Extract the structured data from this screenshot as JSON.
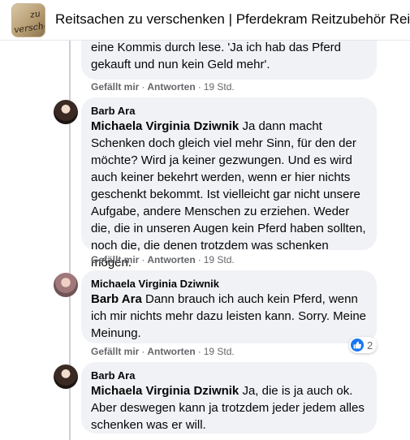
{
  "header": {
    "group_title": "Reitsachen zu verschenken | Pferdekram Reitzubehör Reitsp",
    "thumb_text_top": "zu",
    "thumb_text_bottom": "verschen"
  },
  "comments": [
    {
      "text_lines": [
        "eine Kommis durch lese. 'Ja ich hab das Pferd",
        "gekauft und nun kein Geld mehr'."
      ],
      "actions": {
        "like": "Gefällt mir",
        "reply": "Antworten",
        "time": "19 Std."
      }
    },
    {
      "author": "Barb Ara",
      "mention": "Michaela Virginia Dziwnik",
      "text": "Ja dann macht Schenken doch gleich viel mehr Sinn, für den der möchte? Wird ja keiner gezwungen. Und es wird auch keiner bekehrt werden, wenn er hier nichts geschenkt bekommt. Ist vielleicht gar nicht unsere Aufgabe, andere Menschen zu erziehen. Weder die, die in unseren Augen kein Pferd haben sollten, noch die, die denen trotzdem was schenken mögen.",
      "actions": {
        "like": "Gefällt mir",
        "reply": "Antworten",
        "time": "19 Std."
      }
    },
    {
      "author": "Michaela Virginia Dziwnik",
      "mention": "Barb Ara",
      "text": "Dann brauch ich auch kein Pferd, wenn ich mir nichts mehr dazu leisten kann. Sorry. Meine Meinung.",
      "reaction_count": "2",
      "actions": {
        "like": "Gefällt mir",
        "reply": "Antworten",
        "time": "19 Std."
      }
    },
    {
      "author": "Barb Ara",
      "mention": "Michaela Virginia Dziwnik",
      "text": "Ja, die is ja auch ok. Aber deswegen kann ja trotzdem jeder jedem alles schenken was er will."
    }
  ],
  "colors": {
    "bubble": "#f0f2f5",
    "meta": "#65676b",
    "like_blue": "#1877f2",
    "thread_line": "#ced0d4"
  }
}
